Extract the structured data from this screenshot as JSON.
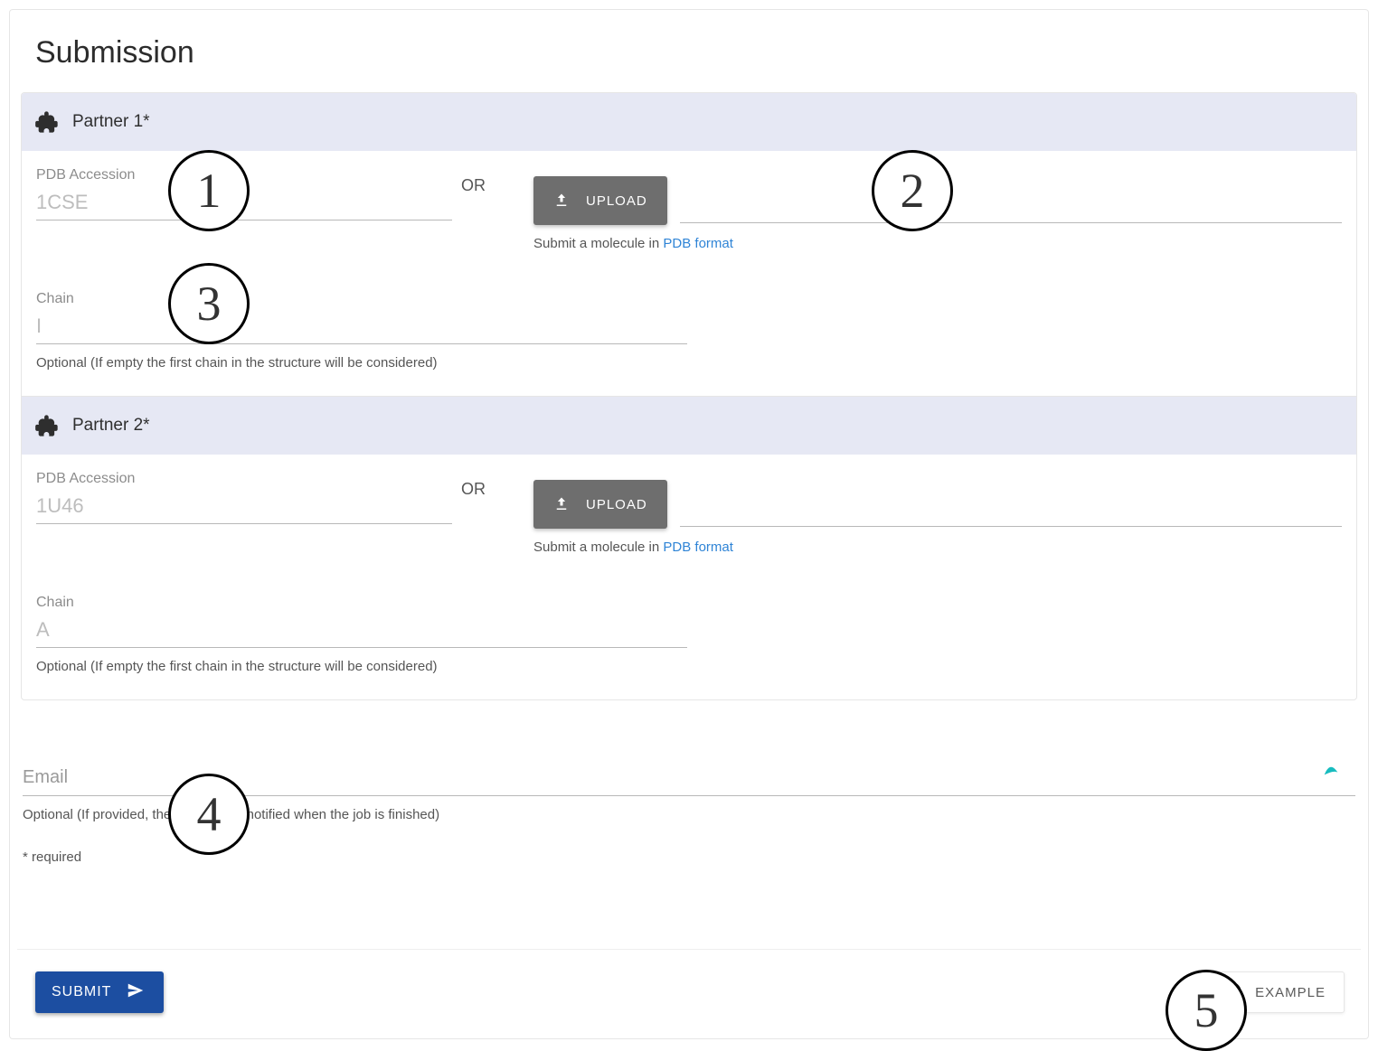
{
  "page": {
    "title": "Submission",
    "required_note": "* required"
  },
  "partner1": {
    "title": "Partner 1*",
    "pdb_label": "PDB Accession",
    "pdb_placeholder": "1CSE",
    "or_label": "OR",
    "upload_label": "UPLOAD",
    "upload_hint_prefix": "Submit a molecule in ",
    "upload_hint_link": "PDB format",
    "chain_label": "Chain",
    "chain_placeholder": "I",
    "chain_hint": "Optional (If empty the first chain in the structure will be considered)"
  },
  "partner2": {
    "title": "Partner 2*",
    "pdb_label": "PDB Accession",
    "pdb_placeholder": "1U46",
    "or_label": "OR",
    "upload_label": "UPLOAD",
    "upload_hint_prefix": "Submit a molecule in ",
    "upload_hint_link": "PDB format",
    "chain_label": "Chain",
    "chain_placeholder": "A",
    "chain_hint": "Optional (If empty the first chain in the structure will be considered)"
  },
  "email": {
    "placeholder": "Email",
    "hint": "Optional (If provided, the user will be notified when the job is finished)"
  },
  "footer": {
    "submit_label": "SUBMIT",
    "example_label": "EXAMPLE"
  },
  "callouts": {
    "c1": "1",
    "c2": "2",
    "c3": "3",
    "c4": "4",
    "c5": "5"
  }
}
